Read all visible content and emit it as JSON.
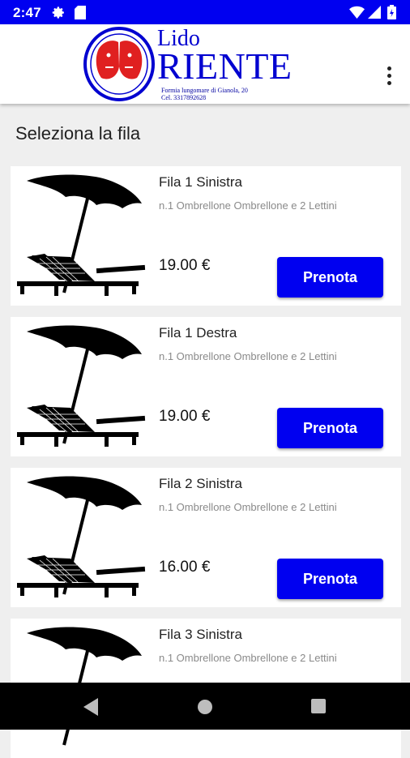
{
  "status": {
    "time": "2:47"
  },
  "logo": {
    "line1": "Lido",
    "line2": "RIENTE",
    "address1": "Formia lungomare di Gianola, 20",
    "address2": "Cel. 3317892628"
  },
  "page_title": "Seleziona la fila",
  "cards": [
    {
      "title": "Fila 1 Sinistra",
      "desc": "n.1 Ombrellone Ombrellone e 2 Lettini",
      "price": "19.00 €",
      "button": "Prenota"
    },
    {
      "title": "Fila 1 Destra",
      "desc": "n.1 Ombrellone Ombrellone e 2 Lettini",
      "price": "19.00 €",
      "button": "Prenota"
    },
    {
      "title": "Fila 2 Sinistra",
      "desc": "n.1 Ombrellone Ombrellone e 2 Lettini",
      "price": "16.00 €",
      "button": "Prenota"
    },
    {
      "title": "Fila 3 Sinistra",
      "desc": "n.1 Ombrellone Ombrellone e 2 Lettini",
      "price": "",
      "button": ""
    }
  ],
  "colors": {
    "accent": "#0000f0",
    "logo": "#0000d0",
    "logo_red": "#e02020"
  }
}
